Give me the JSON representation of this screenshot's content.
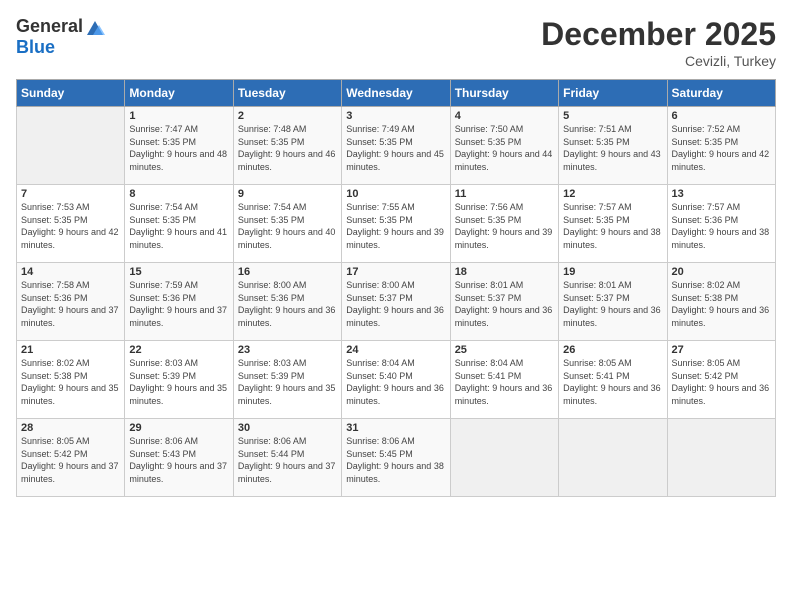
{
  "header": {
    "logo_general": "General",
    "logo_blue": "Blue",
    "title": "December 2025",
    "subtitle": "Cevizli, Turkey"
  },
  "weekdays": [
    "Sunday",
    "Monday",
    "Tuesday",
    "Wednesday",
    "Thursday",
    "Friday",
    "Saturday"
  ],
  "weeks": [
    [
      {
        "num": "",
        "sunrise": "",
        "sunset": "",
        "daylight": ""
      },
      {
        "num": "1",
        "sunrise": "Sunrise: 7:47 AM",
        "sunset": "Sunset: 5:35 PM",
        "daylight": "Daylight: 9 hours and 48 minutes."
      },
      {
        "num": "2",
        "sunrise": "Sunrise: 7:48 AM",
        "sunset": "Sunset: 5:35 PM",
        "daylight": "Daylight: 9 hours and 46 minutes."
      },
      {
        "num": "3",
        "sunrise": "Sunrise: 7:49 AM",
        "sunset": "Sunset: 5:35 PM",
        "daylight": "Daylight: 9 hours and 45 minutes."
      },
      {
        "num": "4",
        "sunrise": "Sunrise: 7:50 AM",
        "sunset": "Sunset: 5:35 PM",
        "daylight": "Daylight: 9 hours and 44 minutes."
      },
      {
        "num": "5",
        "sunrise": "Sunrise: 7:51 AM",
        "sunset": "Sunset: 5:35 PM",
        "daylight": "Daylight: 9 hours and 43 minutes."
      },
      {
        "num": "6",
        "sunrise": "Sunrise: 7:52 AM",
        "sunset": "Sunset: 5:35 PM",
        "daylight": "Daylight: 9 hours and 42 minutes."
      }
    ],
    [
      {
        "num": "7",
        "sunrise": "Sunrise: 7:53 AM",
        "sunset": "Sunset: 5:35 PM",
        "daylight": "Daylight: 9 hours and 42 minutes."
      },
      {
        "num": "8",
        "sunrise": "Sunrise: 7:54 AM",
        "sunset": "Sunset: 5:35 PM",
        "daylight": "Daylight: 9 hours and 41 minutes."
      },
      {
        "num": "9",
        "sunrise": "Sunrise: 7:54 AM",
        "sunset": "Sunset: 5:35 PM",
        "daylight": "Daylight: 9 hours and 40 minutes."
      },
      {
        "num": "10",
        "sunrise": "Sunrise: 7:55 AM",
        "sunset": "Sunset: 5:35 PM",
        "daylight": "Daylight: 9 hours and 39 minutes."
      },
      {
        "num": "11",
        "sunrise": "Sunrise: 7:56 AM",
        "sunset": "Sunset: 5:35 PM",
        "daylight": "Daylight: 9 hours and 39 minutes."
      },
      {
        "num": "12",
        "sunrise": "Sunrise: 7:57 AM",
        "sunset": "Sunset: 5:35 PM",
        "daylight": "Daylight: 9 hours and 38 minutes."
      },
      {
        "num": "13",
        "sunrise": "Sunrise: 7:57 AM",
        "sunset": "Sunset: 5:36 PM",
        "daylight": "Daylight: 9 hours and 38 minutes."
      }
    ],
    [
      {
        "num": "14",
        "sunrise": "Sunrise: 7:58 AM",
        "sunset": "Sunset: 5:36 PM",
        "daylight": "Daylight: 9 hours and 37 minutes."
      },
      {
        "num": "15",
        "sunrise": "Sunrise: 7:59 AM",
        "sunset": "Sunset: 5:36 PM",
        "daylight": "Daylight: 9 hours and 37 minutes."
      },
      {
        "num": "16",
        "sunrise": "Sunrise: 8:00 AM",
        "sunset": "Sunset: 5:36 PM",
        "daylight": "Daylight: 9 hours and 36 minutes."
      },
      {
        "num": "17",
        "sunrise": "Sunrise: 8:00 AM",
        "sunset": "Sunset: 5:37 PM",
        "daylight": "Daylight: 9 hours and 36 minutes."
      },
      {
        "num": "18",
        "sunrise": "Sunrise: 8:01 AM",
        "sunset": "Sunset: 5:37 PM",
        "daylight": "Daylight: 9 hours and 36 minutes."
      },
      {
        "num": "19",
        "sunrise": "Sunrise: 8:01 AM",
        "sunset": "Sunset: 5:37 PM",
        "daylight": "Daylight: 9 hours and 36 minutes."
      },
      {
        "num": "20",
        "sunrise": "Sunrise: 8:02 AM",
        "sunset": "Sunset: 5:38 PM",
        "daylight": "Daylight: 9 hours and 36 minutes."
      }
    ],
    [
      {
        "num": "21",
        "sunrise": "Sunrise: 8:02 AM",
        "sunset": "Sunset: 5:38 PM",
        "daylight": "Daylight: 9 hours and 35 minutes."
      },
      {
        "num": "22",
        "sunrise": "Sunrise: 8:03 AM",
        "sunset": "Sunset: 5:39 PM",
        "daylight": "Daylight: 9 hours and 35 minutes."
      },
      {
        "num": "23",
        "sunrise": "Sunrise: 8:03 AM",
        "sunset": "Sunset: 5:39 PM",
        "daylight": "Daylight: 9 hours and 35 minutes."
      },
      {
        "num": "24",
        "sunrise": "Sunrise: 8:04 AM",
        "sunset": "Sunset: 5:40 PM",
        "daylight": "Daylight: 9 hours and 36 minutes."
      },
      {
        "num": "25",
        "sunrise": "Sunrise: 8:04 AM",
        "sunset": "Sunset: 5:41 PM",
        "daylight": "Daylight: 9 hours and 36 minutes."
      },
      {
        "num": "26",
        "sunrise": "Sunrise: 8:05 AM",
        "sunset": "Sunset: 5:41 PM",
        "daylight": "Daylight: 9 hours and 36 minutes."
      },
      {
        "num": "27",
        "sunrise": "Sunrise: 8:05 AM",
        "sunset": "Sunset: 5:42 PM",
        "daylight": "Daylight: 9 hours and 36 minutes."
      }
    ],
    [
      {
        "num": "28",
        "sunrise": "Sunrise: 8:05 AM",
        "sunset": "Sunset: 5:42 PM",
        "daylight": "Daylight: 9 hours and 37 minutes."
      },
      {
        "num": "29",
        "sunrise": "Sunrise: 8:06 AM",
        "sunset": "Sunset: 5:43 PM",
        "daylight": "Daylight: 9 hours and 37 minutes."
      },
      {
        "num": "30",
        "sunrise": "Sunrise: 8:06 AM",
        "sunset": "Sunset: 5:44 PM",
        "daylight": "Daylight: 9 hours and 37 minutes."
      },
      {
        "num": "31",
        "sunrise": "Sunrise: 8:06 AM",
        "sunset": "Sunset: 5:45 PM",
        "daylight": "Daylight: 9 hours and 38 minutes."
      },
      {
        "num": "",
        "sunrise": "",
        "sunset": "",
        "daylight": ""
      },
      {
        "num": "",
        "sunrise": "",
        "sunset": "",
        "daylight": ""
      },
      {
        "num": "",
        "sunrise": "",
        "sunset": "",
        "daylight": ""
      }
    ]
  ]
}
